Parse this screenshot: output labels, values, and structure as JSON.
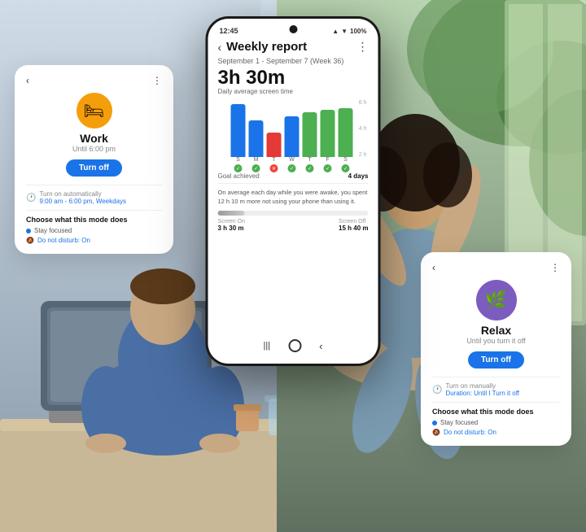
{
  "background": {
    "left_color_top": "#c5d5e5",
    "left_color_bottom": "#8898a8",
    "right_color_top": "#a8c8a0",
    "right_color_bottom": "#607060"
  },
  "phone_center": {
    "status_bar": {
      "time": "12:45",
      "signal": "▲▼",
      "wifi": "WiFi",
      "battery": "100%"
    },
    "header": {
      "back_label": "‹",
      "title": "Weekly report",
      "menu_label": "⋮"
    },
    "date_range": "September 1 - September 7 (Week 36)",
    "screen_time": "3h 30m",
    "screen_time_label": "Daily average screen time",
    "chart": {
      "y_labels": [
        "6h",
        "4h",
        "2h"
      ],
      "x_labels": [
        "S",
        "M",
        "T",
        "W",
        "T",
        "F",
        "S"
      ],
      "bars": [
        {
          "height": 65,
          "color": "#1a73e8"
        },
        {
          "height": 45,
          "color": "#1a73e8"
        },
        {
          "height": 30,
          "color": "#e53935"
        },
        {
          "height": 50,
          "color": "#1a73e8"
        },
        {
          "height": 55,
          "color": "#4CAF50"
        },
        {
          "height": 58,
          "color": "#4CAF50"
        },
        {
          "height": 60,
          "color": "#4CAF50"
        }
      ],
      "icons": [
        "check",
        "check",
        "x",
        "check",
        "check",
        "check",
        "check"
      ]
    },
    "goal_achieved_label": "Goal achieved",
    "goal_achieved_value": "4 days",
    "description": "On average each day while you were awake, you spent 12 h 10 m more not using your phone than using it.",
    "progress": {
      "screen_on_label": "Screen On",
      "screen_on_value": "3 h 30 m",
      "screen_off_label": "Screen Off",
      "screen_off_value": "15 h 40 m"
    },
    "nav": {
      "lines_icon": "|||",
      "circle_icon": "○",
      "back_icon": "<"
    }
  },
  "card_left": {
    "back_label": "‹",
    "menu_label": "⋮",
    "icon_bg": "#f59e0b",
    "icon_symbol": "🛏",
    "title": "Work",
    "subtitle": "Until 6:00 pm",
    "turn_off_label": "Turn off",
    "auto_section_label": "Turn on automatically",
    "auto_schedule_icon": "🕐",
    "auto_schedule_value": "9:00 am - 6:00 pm, Weekdays",
    "section_title": "Choose what this mode does",
    "stay_focused_label": "Stay focused",
    "dnd_label": "Do not disturb: On",
    "dnd_icon": "🔕"
  },
  "card_right": {
    "back_label": "‹",
    "menu_label": "⋮",
    "icon_bg": "#7c5cbf",
    "icon_symbol": "🌿",
    "title": "Relax",
    "subtitle": "Until you turn it off",
    "turn_off_label": "Turn off",
    "auto_section_label": "Turn on manually",
    "duration_icon": "🕐",
    "duration_value": "Duration: Until I Turn it off",
    "section_title": "Choose what this mode does",
    "stay_focused_label": "Stay focused",
    "dnd_label": "Do not disturb: On",
    "dnd_icon": "🔕"
  }
}
